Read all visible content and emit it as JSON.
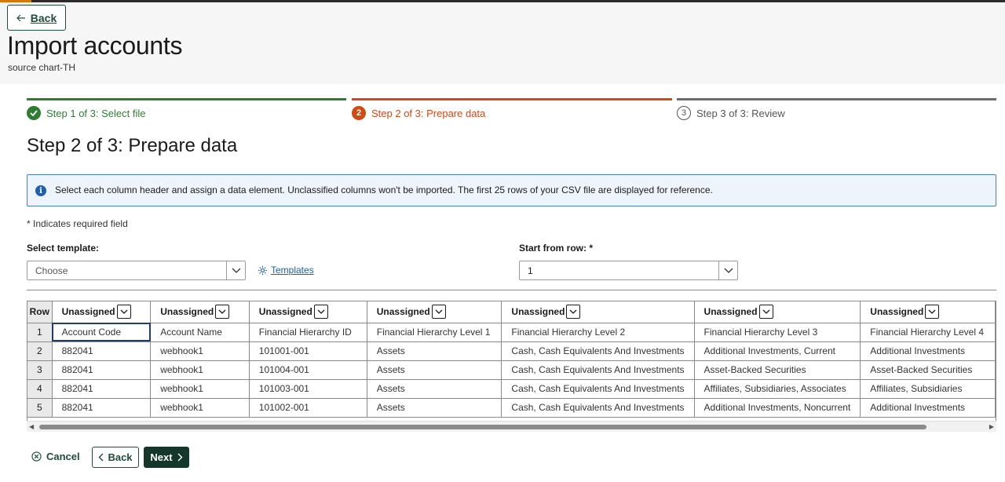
{
  "header": {
    "back_label": "Back",
    "title": "Import accounts",
    "subtitle": "source chart-TH"
  },
  "steps": [
    {
      "label": "Step 1 of 3: Select file",
      "state": "complete",
      "icon": "check-icon"
    },
    {
      "label": "Step 2 of 3: Prepare data",
      "state": "current",
      "number": "2"
    },
    {
      "label": "Step 3 of 3: Review",
      "state": "upcoming",
      "number": "3"
    }
  ],
  "section_title": "Step 2 of 3: Prepare data",
  "info_banner": "Select each column header and assign a data element. Unclassified columns won't be imported. The first 25 rows of your CSV file are displayed for reference.",
  "required_note": "* Indicates required field",
  "template": {
    "label": "Select template:",
    "placeholder": "Choose",
    "link_label": "Templates"
  },
  "start_row": {
    "label": "Start from row: *",
    "value": "1"
  },
  "table": {
    "row_header": "Row",
    "columns": [
      "Unassigned",
      "Unassigned",
      "Unassigned",
      "Unassigned",
      "Unassigned",
      "Unassigned",
      "Unassigned"
    ],
    "rows": [
      {
        "num": "1",
        "cells": [
          "Account Code",
          "Account Name",
          "Financial Hierarchy ID",
          "Financial Hierarchy Level 1",
          "Financial Hierarchy Level 2",
          "Financial Hierarchy Level 3",
          "Financial Hierarchy Level 4"
        ]
      },
      {
        "num": "2",
        "cells": [
          "882041",
          "webhook1",
          "101001-001",
          "Assets",
          "Cash, Cash Equivalents And Investments",
          "Additional Investments, Current",
          "Additional Investments"
        ]
      },
      {
        "num": "3",
        "cells": [
          "882041",
          "webhook1",
          "101004-001",
          "Assets",
          "Cash, Cash Equivalents And Investments",
          "Asset-Backed Securities",
          "Asset-Backed Securities"
        ]
      },
      {
        "num": "4",
        "cells": [
          "882041",
          "webhook1",
          "101003-001",
          "Assets",
          "Cash, Cash Equivalents And Investments",
          "Affiliates, Subsidiaries, Associates",
          "Affiliates, Subsidiaries"
        ]
      },
      {
        "num": "5",
        "cells": [
          "882041",
          "webhook1",
          "101002-001",
          "Assets",
          "Cash, Cash Equivalents And Investments",
          "Additional Investments, Noncurrent",
          "Additional Investments"
        ]
      }
    ]
  },
  "footer": {
    "cancel_label": "Cancel",
    "back_label": "Back",
    "next_label": "Next"
  },
  "colors": {
    "complete": "#2e7d32",
    "current": "#d24a12",
    "primary_button": "#14372b",
    "info_border": "#4c7fbf"
  }
}
